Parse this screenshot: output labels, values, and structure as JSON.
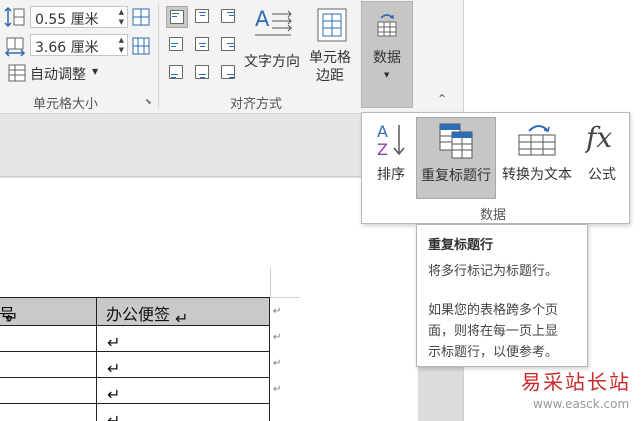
{
  "cell_size": {
    "height_value": "0.55 厘米",
    "width_value": "3.66 厘米",
    "autofit_label": "自动调整",
    "group_label": "单元格大小"
  },
  "alignment": {
    "text_direction_label": "文字方向",
    "cell_margin_label": "单元格\n边距",
    "group_label": "对齐方式"
  },
  "data_button": {
    "label": "数据"
  },
  "data_panel": {
    "items": [
      {
        "label": "排序"
      },
      {
        "label": "重复标题行"
      },
      {
        "label": "转换为文本"
      },
      {
        "label": "公式"
      }
    ],
    "group_label": "数据"
  },
  "tooltip": {
    "title": "重复标题行",
    "line1": "将多行标记为标题行。",
    "line2": "如果您的表格跨多个页",
    "line3": "面，则将在每一页上显",
    "line4": "示标题行，以便参考。"
  },
  "table": {
    "header_left": "号",
    "header_right": "办公便签"
  },
  "watermark": {
    "text": "易采站长站",
    "url": "www.easck.com"
  },
  "colors": {
    "selected_bg": "#c6c6c6",
    "accent_blue": "#2c6bb5",
    "watermark_red": "#c92a2a"
  }
}
